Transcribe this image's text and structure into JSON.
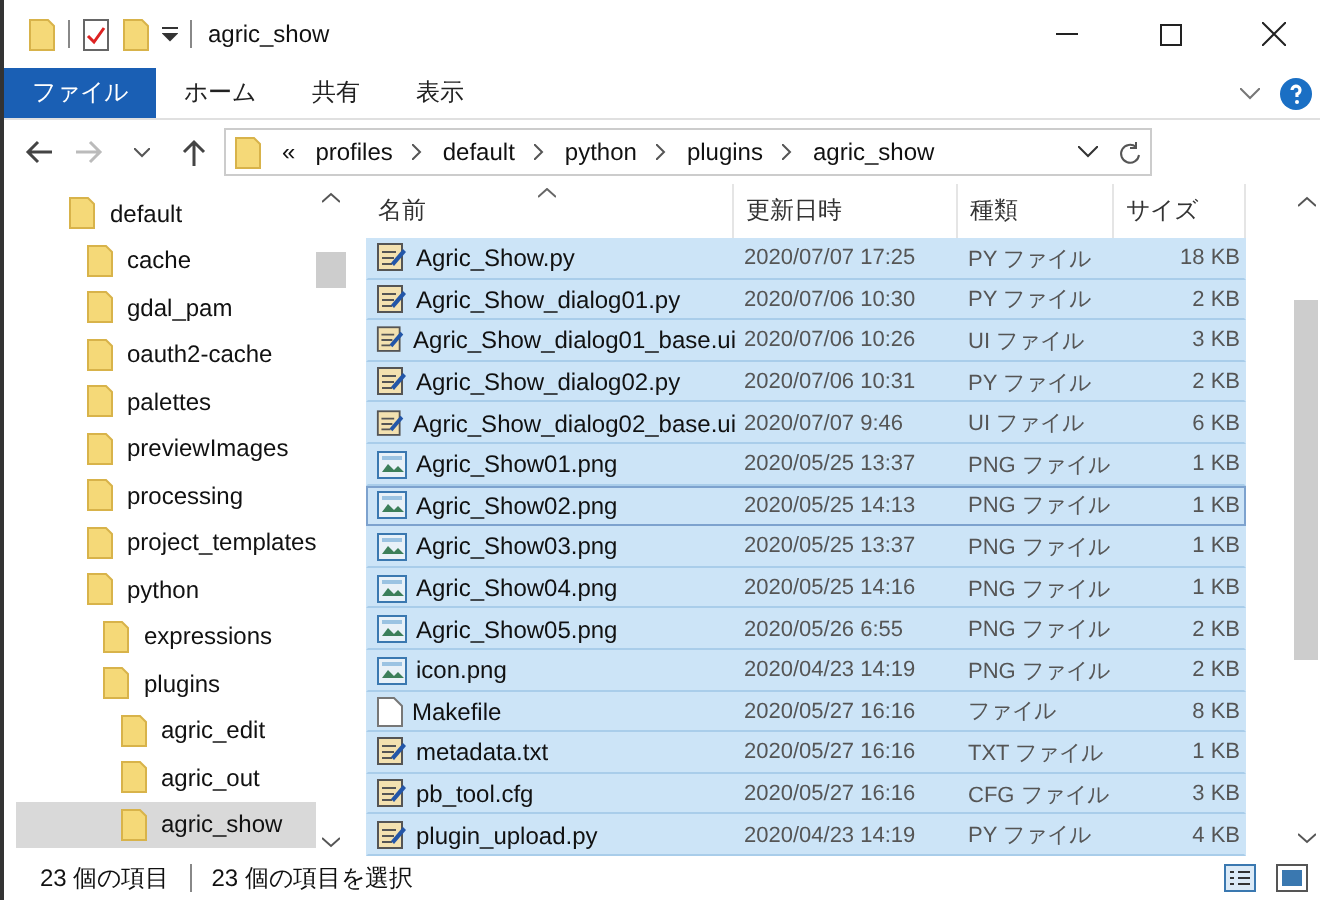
{
  "window": {
    "title": "agric_show"
  },
  "ribbon_tabs": [
    {
      "label": "ファイル",
      "selected": true
    },
    {
      "label": "ホーム",
      "selected": false
    },
    {
      "label": "共有",
      "selected": false
    },
    {
      "label": "表示",
      "selected": false
    }
  ],
  "address": {
    "prefix": "«",
    "segments": [
      "profiles",
      "default",
      "python",
      "plugins",
      "agric_show"
    ]
  },
  "tree": [
    {
      "label": "default",
      "selected": false,
      "children": [
        {
          "label": "cache",
          "selected": false
        },
        {
          "label": "gdal_pam",
          "selected": false
        },
        {
          "label": "oauth2-cache",
          "selected": false
        },
        {
          "label": "palettes",
          "selected": false
        },
        {
          "label": "previewImages",
          "selected": false
        },
        {
          "label": "processing",
          "selected": false
        },
        {
          "label": "project_templates",
          "selected": false
        },
        {
          "label": "python",
          "selected": false,
          "children": [
            {
              "label": "expressions",
              "selected": false
            },
            {
              "label": "plugins",
              "selected": false,
              "children": [
                {
                  "label": "agric_edit",
                  "selected": false
                },
                {
                  "label": "agric_out",
                  "selected": false
                },
                {
                  "label": "agric_show",
                  "selected": true
                }
              ]
            }
          ]
        }
      ]
    }
  ],
  "columns": [
    "名前",
    "更新日時",
    "種類",
    "サイズ"
  ],
  "files": [
    {
      "name": "Agric_Show.py",
      "date": "2020/07/07 17:25",
      "type": "PY ファイル",
      "size": "18 KB",
      "kind": "script",
      "selected": true,
      "focused": false
    },
    {
      "name": "Agric_Show_dialog01.py",
      "date": "2020/07/06 10:30",
      "type": "PY ファイル",
      "size": "2 KB",
      "kind": "script",
      "selected": true,
      "focused": false
    },
    {
      "name": "Agric_Show_dialog01_base.ui",
      "date": "2020/07/06 10:26",
      "type": "UI ファイル",
      "size": "3 KB",
      "kind": "script",
      "selected": true,
      "focused": false
    },
    {
      "name": "Agric_Show_dialog02.py",
      "date": "2020/07/06 10:31",
      "type": "PY ファイル",
      "size": "2 KB",
      "kind": "script",
      "selected": true,
      "focused": false
    },
    {
      "name": "Agric_Show_dialog02_base.ui",
      "date": "2020/07/07 9:46",
      "type": "UI ファイル",
      "size": "6 KB",
      "kind": "script",
      "selected": true,
      "focused": false
    },
    {
      "name": "Agric_Show01.png",
      "date": "2020/05/25 13:37",
      "type": "PNG ファイル",
      "size": "1 KB",
      "kind": "image",
      "selected": true,
      "focused": false
    },
    {
      "name": "Agric_Show02.png",
      "date": "2020/05/25 14:13",
      "type": "PNG ファイル",
      "size": "1 KB",
      "kind": "image",
      "selected": true,
      "focused": true
    },
    {
      "name": "Agric_Show03.png",
      "date": "2020/05/25 13:37",
      "type": "PNG ファイル",
      "size": "1 KB",
      "kind": "image",
      "selected": true,
      "focused": false
    },
    {
      "name": "Agric_Show04.png",
      "date": "2020/05/25 14:16",
      "type": "PNG ファイル",
      "size": "1 KB",
      "kind": "image",
      "selected": true,
      "focused": false
    },
    {
      "name": "Agric_Show05.png",
      "date": "2020/05/26 6:55",
      "type": "PNG ファイル",
      "size": "2 KB",
      "kind": "image",
      "selected": true,
      "focused": false
    },
    {
      "name": "icon.png",
      "date": "2020/04/23 14:19",
      "type": "PNG ファイル",
      "size": "2 KB",
      "kind": "image",
      "selected": true,
      "focused": false
    },
    {
      "name": "Makefile",
      "date": "2020/05/27 16:16",
      "type": "ファイル",
      "size": "8 KB",
      "kind": "blank",
      "selected": true,
      "focused": false
    },
    {
      "name": "metadata.txt",
      "date": "2020/05/27 16:16",
      "type": "TXT ファイル",
      "size": "1 KB",
      "kind": "script",
      "selected": true,
      "focused": false
    },
    {
      "name": "pb_tool.cfg",
      "date": "2020/05/27 16:16",
      "type": "CFG ファイル",
      "size": "3 KB",
      "kind": "script",
      "selected": true,
      "focused": false
    },
    {
      "name": "plugin_upload.py",
      "date": "2020/04/23 14:19",
      "type": "PY ファイル",
      "size": "4 KB",
      "kind": "script",
      "selected": true,
      "focused": false
    }
  ],
  "status_bar": {
    "count": "23 個の項目",
    "selection": "23 個の項目を選択"
  }
}
